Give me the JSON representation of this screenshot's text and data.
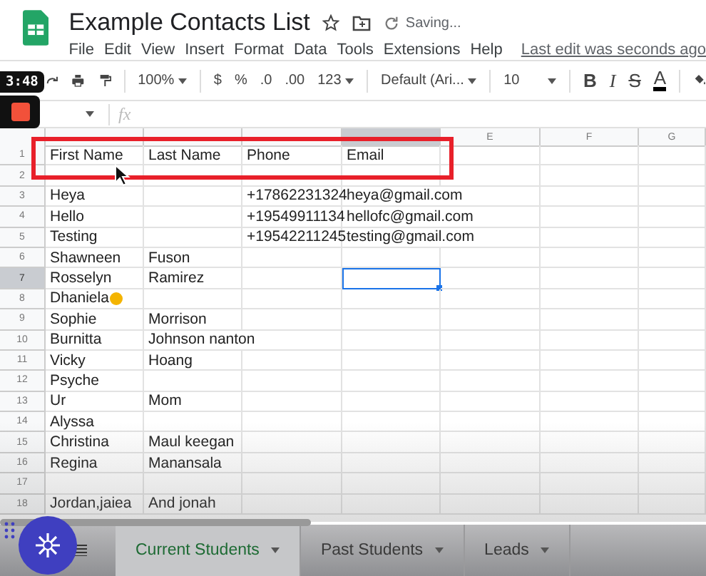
{
  "document": {
    "title": "Example Contacts List",
    "status": "Saving...",
    "last_edit": "Last edit was seconds ago"
  },
  "menu": [
    "File",
    "Edit",
    "View",
    "Insert",
    "Format",
    "Data",
    "Tools",
    "Extensions",
    "Help"
  ],
  "toolbar": {
    "zoom": "100%",
    "currency": "$",
    "percent": "%",
    "decrease_decimals": ".0",
    "increase_decimals": ".00",
    "number_format": "123",
    "font": "Default (Ari...",
    "font_size": "10",
    "bold": "B",
    "italic": "I",
    "strikethrough": "S",
    "text_color": "A"
  },
  "recording": {
    "timer": "3:48"
  },
  "formula_bar": {
    "fx": "fx"
  },
  "grid": {
    "columns": [
      {
        "selected": false
      },
      {
        "selected": false
      },
      {
        "selected": false
      },
      {
        "selected": true
      },
      {
        "label": "E",
        "selected": false
      },
      {
        "label": "F",
        "selected": false
      },
      {
        "label": "G",
        "selected": false
      }
    ],
    "rows": [
      {
        "number": "1",
        "selected": false,
        "emoji": false,
        "cells": [
          "First Name",
          "Last Name",
          "Phone",
          "Email"
        ]
      },
      {
        "number": "2",
        "selected": false,
        "emoji": false,
        "cells": [
          "",
          "",
          "",
          ""
        ]
      },
      {
        "number": "3",
        "selected": false,
        "emoji": false,
        "cells": [
          "Heya",
          "",
          "+17862231324",
          "heya@gmail.com"
        ]
      },
      {
        "number": "4",
        "selected": false,
        "emoji": false,
        "cells": [
          "Hello",
          "",
          "+19549911134",
          "hellofc@gmail.com"
        ]
      },
      {
        "number": "5",
        "selected": false,
        "emoji": false,
        "cells": [
          "Testing",
          "",
          "+19542211245",
          "testing@gmail.com"
        ]
      },
      {
        "number": "6",
        "selected": false,
        "emoji": false,
        "cells": [
          "Shawneen",
          "Fuson",
          "",
          ""
        ]
      },
      {
        "number": "7",
        "selected": true,
        "emoji": false,
        "cells": [
          "Rosselyn",
          "Ramirez",
          "",
          ""
        ]
      },
      {
        "number": "8",
        "selected": false,
        "emoji": true,
        "cells": [
          "Dhaniela",
          "",
          "",
          ""
        ]
      },
      {
        "number": "9",
        "selected": false,
        "emoji": false,
        "cells": [
          "Sophie",
          "Morrison",
          "",
          ""
        ]
      },
      {
        "number": "10",
        "selected": false,
        "emoji": false,
        "cells": [
          "Burnitta",
          "Johnson nanton",
          "",
          ""
        ]
      },
      {
        "number": "11",
        "selected": false,
        "emoji": false,
        "cells": [
          "Vicky",
          "Hoang",
          "",
          ""
        ]
      },
      {
        "number": "12",
        "selected": false,
        "emoji": false,
        "cells": [
          "Psyche",
          "",
          "",
          ""
        ]
      },
      {
        "number": "13",
        "selected": false,
        "emoji": false,
        "cells": [
          "Ur",
          "Mom",
          "",
          ""
        ]
      },
      {
        "number": "14",
        "selected": false,
        "emoji": false,
        "cells": [
          "Alyssa",
          "",
          "",
          ""
        ]
      },
      {
        "number": "15",
        "selected": false,
        "emoji": false,
        "cells": [
          "Christina",
          "Maul keegan",
          "",
          ""
        ]
      },
      {
        "number": "16",
        "selected": false,
        "emoji": false,
        "cells": [
          "Regina",
          "Manansala",
          "",
          ""
        ]
      },
      {
        "number": "17",
        "selected": false,
        "emoji": false,
        "cells": [
          "",
          "",
          "",
          ""
        ]
      },
      {
        "number": "18",
        "selected": false,
        "emoji": false,
        "cells": [
          "Jordan,jaiea",
          "And jonah",
          "",
          ""
        ]
      }
    ]
  },
  "sheet_tabs": [
    {
      "label": "Current Students",
      "selected": true
    },
    {
      "label": "Past Students",
      "selected": false
    },
    {
      "label": "Leads",
      "selected": false
    }
  ]
}
